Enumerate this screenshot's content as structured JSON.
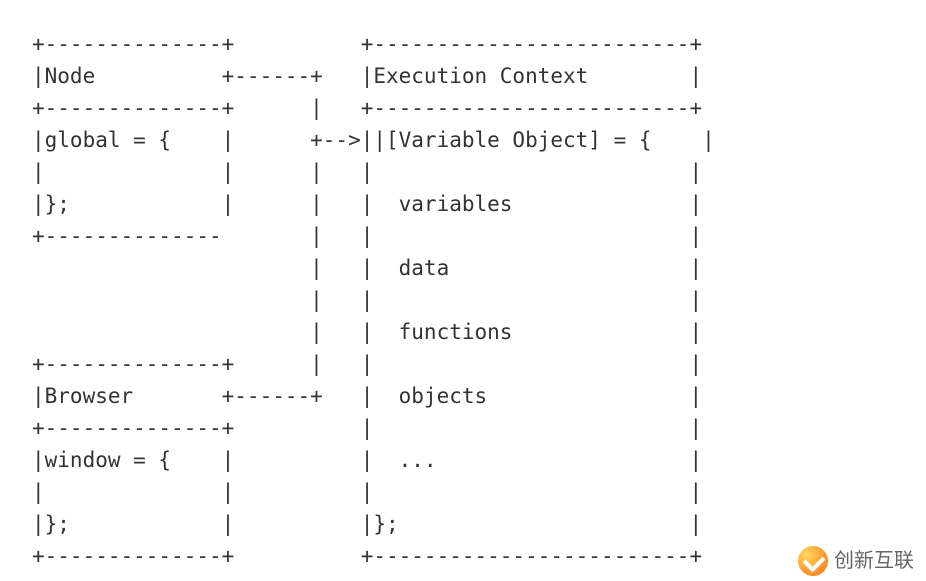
{
  "diagram": {
    "lines": [
      "+--------------+          +-------------------------+",
      "|Node          +------+   |Execution Context        |",
      "+--------------+      |   +-------------------------+",
      "|global = {    |      +-->||[Variable Object] = {    |",
      "|              |      |   |                         |",
      "|};            |      |   |  variables              |",
      "+--------------       |   |                         |",
      "                      |   |  data                   |",
      "                      |   |                         |",
      "                      |   |  functions              |",
      "+--------------+      |   |                         |",
      "|Browser       +------+   |  objects                |",
      "+--------------+          |                         |",
      "|window = {    |          |  ...                    |",
      "|              |          |                         |",
      "|};            |          |};                       |",
      "+--------------+          +-------------------------+"
    ]
  },
  "boxes": {
    "node": {
      "title": "Node",
      "body": [
        "global = {",
        "",
        "};"
      ]
    },
    "browser": {
      "title": "Browser",
      "body": [
        "window = {",
        "",
        "};"
      ]
    },
    "execution_context": {
      "title": "Execution Context",
      "body": [
        "[Variable Object] = {",
        "",
        "  variables",
        "",
        "  data",
        "",
        "  functions",
        "",
        "  objects",
        "",
        "  ...",
        "",
        "};"
      ]
    }
  },
  "connector": {
    "label": "-->",
    "from": [
      "Node",
      "Browser"
    ],
    "to": "Execution Context"
  },
  "watermark": {
    "text": "创新互联"
  }
}
